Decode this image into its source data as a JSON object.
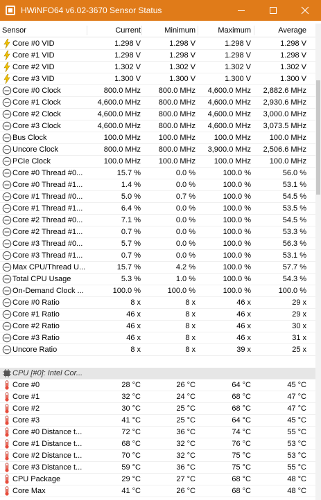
{
  "window": {
    "title": "HWiNFO64 v6.02-3670 Sensor Status",
    "title_bar_color": "#e07b19"
  },
  "columns": {
    "sensor": "Sensor",
    "current": "Current",
    "minimum": "Minimum",
    "maximum": "Maximum",
    "average": "Average"
  },
  "rows": [
    {
      "type": "sensor",
      "icon": "voltage-icon",
      "name": "Core #0 VID",
      "current": "1.298 V",
      "minimum": "1.298 V",
      "maximum": "1.298 V",
      "average": "1.298 V"
    },
    {
      "type": "sensor",
      "icon": "voltage-icon",
      "name": "Core #1 VID",
      "current": "1.298 V",
      "minimum": "1.298 V",
      "maximum": "1.298 V",
      "average": "1.298 V"
    },
    {
      "type": "sensor",
      "icon": "voltage-icon",
      "name": "Core #2 VID",
      "current": "1.302 V",
      "minimum": "1.302 V",
      "maximum": "1.302 V",
      "average": "1.302 V"
    },
    {
      "type": "sensor",
      "icon": "voltage-icon",
      "name": "Core #3 VID",
      "current": "1.300 V",
      "minimum": "1.300 V",
      "maximum": "1.300 V",
      "average": "1.300 V"
    },
    {
      "type": "sensor",
      "icon": "gauge-icon",
      "name": "Core #0 Clock",
      "current": "800.0 MHz",
      "minimum": "800.0 MHz",
      "maximum": "4,600.0 MHz",
      "average": "2,882.6 MHz"
    },
    {
      "type": "sensor",
      "icon": "gauge-icon",
      "name": "Core #1 Clock",
      "current": "4,600.0 MHz",
      "minimum": "800.0 MHz",
      "maximum": "4,600.0 MHz",
      "average": "2,930.6 MHz"
    },
    {
      "type": "sensor",
      "icon": "gauge-icon",
      "name": "Core #2 Clock",
      "current": "4,600.0 MHz",
      "minimum": "800.0 MHz",
      "maximum": "4,600.0 MHz",
      "average": "3,000.0 MHz"
    },
    {
      "type": "sensor",
      "icon": "gauge-icon",
      "name": "Core #3 Clock",
      "current": "4,600.0 MHz",
      "minimum": "800.0 MHz",
      "maximum": "4,600.0 MHz",
      "average": "3,073.5 MHz"
    },
    {
      "type": "sensor",
      "icon": "gauge-icon",
      "name": "Bus Clock",
      "current": "100.0 MHz",
      "minimum": "100.0 MHz",
      "maximum": "100.0 MHz",
      "average": "100.0 MHz"
    },
    {
      "type": "sensor",
      "icon": "gauge-icon",
      "name": "Uncore Clock",
      "current": "800.0 MHz",
      "minimum": "800.0 MHz",
      "maximum": "3,900.0 MHz",
      "average": "2,506.6 MHz"
    },
    {
      "type": "sensor",
      "icon": "gauge-icon",
      "name": "PCIe Clock",
      "current": "100.0 MHz",
      "minimum": "100.0 MHz",
      "maximum": "100.0 MHz",
      "average": "100.0 MHz"
    },
    {
      "type": "sensor",
      "icon": "gauge-icon",
      "name": "Core #0 Thread #0...",
      "current": "15.7 %",
      "minimum": "0.0 %",
      "maximum": "100.0 %",
      "average": "56.0 %"
    },
    {
      "type": "sensor",
      "icon": "gauge-icon",
      "name": "Core #0 Thread #1...",
      "current": "1.4 %",
      "minimum": "0.0 %",
      "maximum": "100.0 %",
      "average": "53.1 %"
    },
    {
      "type": "sensor",
      "icon": "gauge-icon",
      "name": "Core #1 Thread #0...",
      "current": "5.0 %",
      "minimum": "0.7 %",
      "maximum": "100.0 %",
      "average": "54.5 %"
    },
    {
      "type": "sensor",
      "icon": "gauge-icon",
      "name": "Core #1 Thread #1...",
      "current": "6.4 %",
      "minimum": "0.0 %",
      "maximum": "100.0 %",
      "average": "53.5 %"
    },
    {
      "type": "sensor",
      "icon": "gauge-icon",
      "name": "Core #2 Thread #0...",
      "current": "7.1 %",
      "minimum": "0.0 %",
      "maximum": "100.0 %",
      "average": "54.5 %"
    },
    {
      "type": "sensor",
      "icon": "gauge-icon",
      "name": "Core #2 Thread #1...",
      "current": "0.7 %",
      "minimum": "0.0 %",
      "maximum": "100.0 %",
      "average": "53.3 %"
    },
    {
      "type": "sensor",
      "icon": "gauge-icon",
      "name": "Core #3 Thread #0...",
      "current": "5.7 %",
      "minimum": "0.0 %",
      "maximum": "100.0 %",
      "average": "56.3 %"
    },
    {
      "type": "sensor",
      "icon": "gauge-icon",
      "name": "Core #3 Thread #1...",
      "current": "0.7 %",
      "minimum": "0.0 %",
      "maximum": "100.0 %",
      "average": "53.1 %"
    },
    {
      "type": "sensor",
      "icon": "gauge-icon",
      "name": "Max CPU/Thread U...",
      "current": "15.7 %",
      "minimum": "4.2 %",
      "maximum": "100.0 %",
      "average": "57.7 %"
    },
    {
      "type": "sensor",
      "icon": "gauge-icon",
      "name": "Total CPU Usage",
      "current": "5.3 %",
      "minimum": "1.0 %",
      "maximum": "100.0 %",
      "average": "54.3 %"
    },
    {
      "type": "sensor",
      "icon": "gauge-icon",
      "name": "On-Demand Clock ...",
      "current": "100.0 %",
      "minimum": "100.0 %",
      "maximum": "100.0 %",
      "average": "100.0 %"
    },
    {
      "type": "sensor",
      "icon": "gauge-icon",
      "name": "Core #0 Ratio",
      "current": "8 x",
      "minimum": "8 x",
      "maximum": "46 x",
      "average": "29 x"
    },
    {
      "type": "sensor",
      "icon": "gauge-icon",
      "name": "Core #1 Ratio",
      "current": "46 x",
      "minimum": "8 x",
      "maximum": "46 x",
      "average": "29 x"
    },
    {
      "type": "sensor",
      "icon": "gauge-icon",
      "name": "Core #2 Ratio",
      "current": "46 x",
      "minimum": "8 x",
      "maximum": "46 x",
      "average": "30 x"
    },
    {
      "type": "sensor",
      "icon": "gauge-icon",
      "name": "Core #3 Ratio",
      "current": "46 x",
      "minimum": "8 x",
      "maximum": "46 x",
      "average": "31 x"
    },
    {
      "type": "sensor",
      "icon": "gauge-icon",
      "name": "Uncore Ratio",
      "current": "8 x",
      "minimum": "8 x",
      "maximum": "39 x",
      "average": "25 x"
    },
    {
      "type": "blank",
      "icon": "",
      "name": "",
      "current": "",
      "minimum": "",
      "maximum": "",
      "average": ""
    },
    {
      "type": "group",
      "icon": "chip-icon",
      "name": "CPU [#0]: Intel Cor...",
      "current": "",
      "minimum": "",
      "maximum": "",
      "average": ""
    },
    {
      "type": "sensor",
      "icon": "thermometer-icon",
      "name": "Core #0",
      "current": "28 °C",
      "minimum": "26 °C",
      "maximum": "64 °C",
      "average": "45 °C"
    },
    {
      "type": "sensor",
      "icon": "thermometer-icon",
      "name": "Core #1",
      "current": "32 °C",
      "minimum": "24 °C",
      "maximum": "68 °C",
      "average": "47 °C"
    },
    {
      "type": "sensor",
      "icon": "thermometer-icon",
      "name": "Core #2",
      "current": "30 °C",
      "minimum": "25 °C",
      "maximum": "68 °C",
      "average": "47 °C"
    },
    {
      "type": "sensor",
      "icon": "thermometer-icon",
      "name": "Core #3",
      "current": "41 °C",
      "minimum": "25 °C",
      "maximum": "64 °C",
      "average": "45 °C"
    },
    {
      "type": "sensor",
      "icon": "thermometer-icon",
      "name": "Core #0 Distance t...",
      "current": "72 °C",
      "minimum": "36 °C",
      "maximum": "74 °C",
      "average": "55 °C"
    },
    {
      "type": "sensor",
      "icon": "thermometer-icon",
      "name": "Core #1 Distance t...",
      "current": "68 °C",
      "minimum": "32 °C",
      "maximum": "76 °C",
      "average": "53 °C"
    },
    {
      "type": "sensor",
      "icon": "thermometer-icon",
      "name": "Core #2 Distance t...",
      "current": "70 °C",
      "minimum": "32 °C",
      "maximum": "75 °C",
      "average": "53 °C"
    },
    {
      "type": "sensor",
      "icon": "thermometer-icon",
      "name": "Core #3 Distance t...",
      "current": "59 °C",
      "minimum": "36 °C",
      "maximum": "75 °C",
      "average": "55 °C"
    },
    {
      "type": "sensor",
      "icon": "thermometer-icon",
      "name": "CPU Package",
      "current": "29 °C",
      "minimum": "27 °C",
      "maximum": "68 °C",
      "average": "48 °C"
    },
    {
      "type": "sensor",
      "icon": "thermometer-icon",
      "name": "Core Max",
      "current": "41 °C",
      "minimum": "26 °C",
      "maximum": "68 °C",
      "average": "48 °C"
    }
  ]
}
